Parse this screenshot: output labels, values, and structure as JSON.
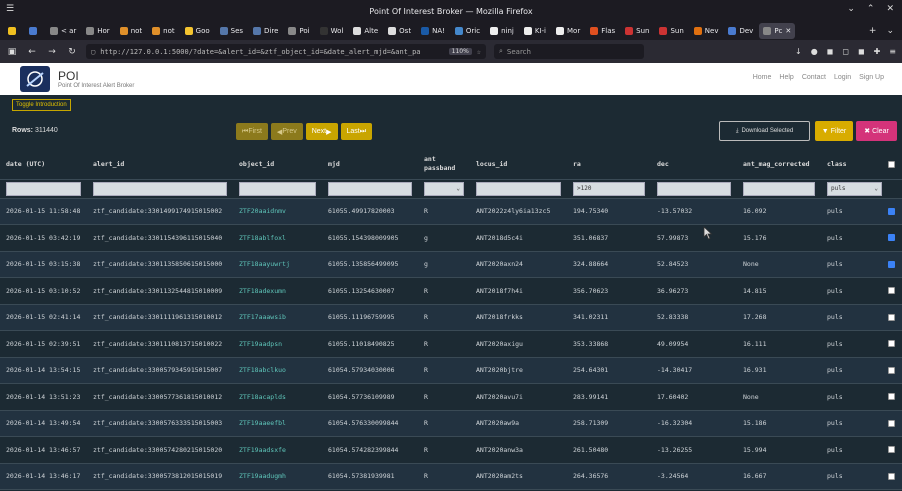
{
  "window": {
    "title": "Point Of Interest Broker — Mozilla Firefox"
  },
  "tabs": [
    {
      "label": "",
      "color": "#f0c020"
    },
    {
      "label": "",
      "color": "#4a7bd0"
    },
    {
      "label": "< ar",
      "color": "#888"
    },
    {
      "label": "Hor",
      "color": "#888"
    },
    {
      "label": "not",
      "color": "#e0902a"
    },
    {
      "label": "not",
      "color": "#e0902a"
    },
    {
      "label": "Goo",
      "color": "#f4c430"
    },
    {
      "label": "Ses",
      "color": "#5577aa"
    },
    {
      "label": "Dire",
      "color": "#5577aa"
    },
    {
      "label": "Poi",
      "color": "#888"
    },
    {
      "label": "Wol",
      "color": "#333"
    },
    {
      "label": "Alte",
      "color": "#ddd"
    },
    {
      "label": "Ost",
      "color": "#ddd"
    },
    {
      "label": "NA!",
      "color": "#1a5aa6"
    },
    {
      "label": "Oric",
      "color": "#4488cc"
    },
    {
      "label": "ninj",
      "color": "#eee"
    },
    {
      "label": "KI-i",
      "color": "#eee"
    },
    {
      "label": "Mor",
      "color": "#eee"
    },
    {
      "label": "Flas",
      "color": "#e05020"
    },
    {
      "label": "Sun",
      "color": "#cc3333"
    },
    {
      "label": "Sun",
      "color": "#cc3333"
    },
    {
      "label": "Nev",
      "color": "#e07010"
    },
    {
      "label": "Dev",
      "color": "#4a7bd0"
    },
    {
      "label": "Pc",
      "color": "#888",
      "active": true
    }
  ],
  "nav": {
    "url": "http://127.0.0.1:5000/?date=&alert_id=&ztf_object_id=&date_alert_mjd=&ant_pa",
    "zoom": "110%",
    "search_placeholder": "Search"
  },
  "app": {
    "title": "POI",
    "subtitle": "Point Of Interest Alert Broker",
    "menu": [
      "Home",
      "Help",
      "Contact",
      "Login",
      "Sign Up"
    ]
  },
  "toolbar": {
    "toggle_intro": "Toggle Introduction",
    "rows_label": "Rows:",
    "rows_count": "311440",
    "first": "First",
    "prev": "Prev",
    "next": "Next",
    "last": "Last",
    "download": "Download Selected",
    "filter": "Filter",
    "clear": "Clear"
  },
  "columns": [
    "date (UTC)",
    "alert_id",
    "object_id",
    "mjd",
    "ant passband",
    "locus_id",
    "ra",
    "dec",
    "ant_mag_corrected",
    "class"
  ],
  "filters": {
    "passband": "",
    "ra": ">120",
    "class": "puls"
  },
  "rows": [
    {
      "date": "2026-01-15 11:58:48",
      "alert_id": "ztf_candidate:3301499174915015002",
      "object_id": "ZTF20aaidnmv",
      "mjd": "61055.49917820003",
      "pb": "R",
      "locus": "ANT2022z4ly6ia13zc5",
      "ra": "194.75340",
      "dec": "-13.57032",
      "mag": "16.092",
      "cls": "puls",
      "sel": true
    },
    {
      "date": "2026-01-15 03:42:19",
      "alert_id": "ztf_candidate:3301154396115015040",
      "object_id": "ZTF18ablfoxl",
      "mjd": "61055.154398009905",
      "pb": "g",
      "locus": "ANT2018d5c4i",
      "ra": "351.06837",
      "dec": "57.99873",
      "mag": "15.176",
      "cls": "puls",
      "sel": true
    },
    {
      "date": "2026-01-15 03:15:38",
      "alert_id": "ztf_candidate:3301135850615015000",
      "object_id": "ZTF18aayuwrtj",
      "mjd": "61055.135856499095",
      "pb": "g",
      "locus": "ANT2020axn24",
      "ra": "324.88664",
      "dec": "52.84523",
      "mag": "None",
      "cls": "puls",
      "sel": true
    },
    {
      "date": "2026-01-15 03:10:52",
      "alert_id": "ztf_candidate:3301132544815010009",
      "object_id": "ZTF18adexumn",
      "mjd": "61055.13254630007",
      "pb": "R",
      "locus": "ANT2018f7h4i",
      "ra": "356.70623",
      "dec": "36.96273",
      "mag": "14.815",
      "cls": "puls",
      "sel": false
    },
    {
      "date": "2026-01-15 02:41:14",
      "alert_id": "ztf_candidate:3301111961315010012",
      "object_id": "ZTF17aaawsib",
      "mjd": "61055.11196759995",
      "pb": "R",
      "locus": "ANT2018frkks",
      "ra": "341.02311",
      "dec": "52.83338",
      "mag": "17.268",
      "cls": "puls",
      "sel": false
    },
    {
      "date": "2026-01-15 02:39:51",
      "alert_id": "ztf_candidate:3301110813715010022",
      "object_id": "ZTF19aadpsn",
      "mjd": "61055.11018490825",
      "pb": "R",
      "locus": "ANT2020axigu",
      "ra": "353.33868",
      "dec": "49.09954",
      "mag": "16.111",
      "cls": "puls",
      "sel": false
    },
    {
      "date": "2026-01-14 13:54:15",
      "alert_id": "ztf_candidate:3300579345915015007",
      "object_id": "ZTF18abclkuo",
      "mjd": "61054.57934030006",
      "pb": "R",
      "locus": "ANT2020bjtre",
      "ra": "254.64301",
      "dec": "-14.30417",
      "mag": "16.931",
      "cls": "puls",
      "sel": false
    },
    {
      "date": "2026-01-14 13:51:23",
      "alert_id": "ztf_candidate:3300577361815010012",
      "object_id": "ZTF18acaplds",
      "mjd": "61054.57736109989",
      "pb": "R",
      "locus": "ANT2020avu7i",
      "ra": "283.99141",
      "dec": "17.60402",
      "mag": "None",
      "cls": "puls",
      "sel": false
    },
    {
      "date": "2026-01-14 13:49:54",
      "alert_id": "ztf_candidate:3300576333515015003",
      "object_id": "ZTF19aaeefbl",
      "mjd": "61054.576330099844",
      "pb": "R",
      "locus": "ANT2020aw9a",
      "ra": "258.71309",
      "dec": "-16.32304",
      "mag": "15.186",
      "cls": "puls",
      "sel": false
    },
    {
      "date": "2026-01-14 13:46:57",
      "alert_id": "ztf_candidate:3300574280215015020",
      "object_id": "ZTF19aadsxfe",
      "mjd": "61054.574282399844",
      "pb": "R",
      "locus": "ANT2020anw3a",
      "ra": "261.50480",
      "dec": "-13.26255",
      "mag": "15.994",
      "cls": "puls",
      "sel": false
    },
    {
      "date": "2026-01-14 13:46:17",
      "alert_id": "ztf_candidate:3300573812015015019",
      "object_id": "ZTF19aadugmh",
      "mjd": "61054.57381939981",
      "pb": "R",
      "locus": "ANT2020am2ts",
      "ra": "264.36576",
      "dec": "-3.24564",
      "mag": "16.667",
      "cls": "puls",
      "sel": false
    }
  ]
}
